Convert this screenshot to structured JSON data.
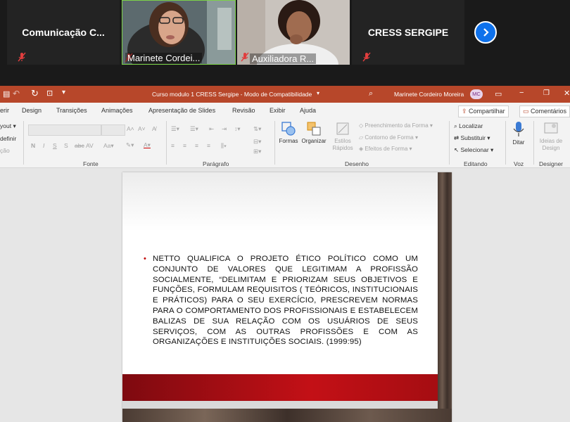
{
  "meeting": {
    "tiles": [
      {
        "label": "Comunicação  C...",
        "type": "text"
      },
      {
        "label": "Marinete Cordei...",
        "type": "video"
      },
      {
        "label": "Auxiliadora R...",
        "type": "video"
      },
      {
        "label": "CRESS SERGIPE",
        "type": "text"
      }
    ],
    "next_icon": "chevron-right-icon",
    "mic_icon": "mic-muted-icon"
  },
  "app": {
    "title": "Curso modulo 1 CRESS Sergipe  -  Modo de Compatibilidade",
    "user_name": "Marinete Cordeiro Moreira",
    "user_initials": "MC",
    "accent": "#b7472a"
  },
  "tabs": [
    "erir",
    "Design",
    "Transições",
    "Animações",
    "Apresentação de Slides",
    "Revisão",
    "Exibir",
    "Ajuda"
  ],
  "share_label": "Compartilhar",
  "comments_label": "Comentários",
  "ribbon": {
    "left_items": [
      "yout",
      "definir",
      "ção"
    ],
    "groups": {
      "font": "Fonte",
      "paragraph": "Parágrafo",
      "drawing": "Desenho",
      "editing": "Editando",
      "voice": "Voz",
      "designer": "Designer"
    },
    "drawing": {
      "shapes": "Formas",
      "arrange": "Organizar",
      "quick_styles_1": "Estilos",
      "quick_styles_2": "Rápidos",
      "fill": "Preenchimento da Forma",
      "outline": "Contorno de Forma",
      "effects": "Efeitos de Forma"
    },
    "editing": {
      "find": "Localizar",
      "replace": "Substituir",
      "select": "Selecionar"
    },
    "voice": {
      "dictate": "Ditar"
    },
    "designer": {
      "ideas_1": "Ideias de",
      "ideas_2": "Design"
    }
  },
  "slide": {
    "body": "NETTO QUALIFICA O PROJETO ÉTICO POLÍTICO COMO UM CONJUNTO DE VALORES QUE LEGITIMAM A PROFISSÃO SOCIALMENTE, “DELIMITAM E PRIORIZAM SEUS OBJETIVOS E FUNÇÕES, FORMULAM REQUISITOS ( TEÓRICOS, INSTITUCIONAIS E PRÁTICOS) PARA O SEU EXERCÍCIO, PRESCREVEM NORMAS PARA O COMPORTAMENTO DOS PROFISSIONAIS   E ESTABELECEM BALIZAS DE SUA RELAÇÃO COM OS USUÁRIOS DE SEUS SERVIÇOS, COM AS OUTRAS PROFISSÕES E COM AS ORGANIZAÇÕES E INSTITUIÇÕES SOCIAIS. (1999:95)",
    "bullet": "•"
  }
}
